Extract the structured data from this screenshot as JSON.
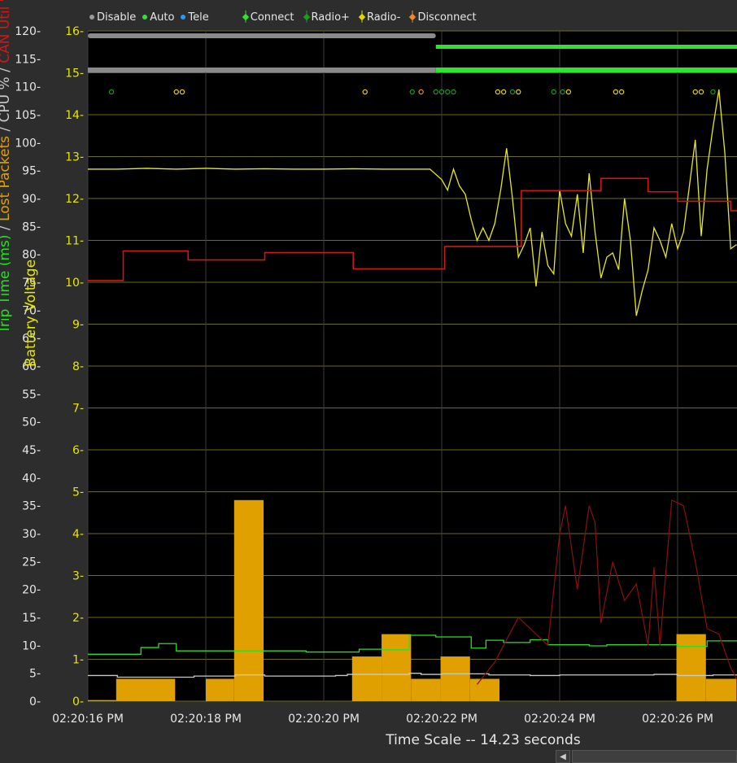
{
  "legend": {
    "modes": [
      {
        "label": "Disable",
        "color": "#9a9a9a"
      },
      {
        "label": "Auto",
        "color": "#31e331"
      },
      {
        "label": "Tele",
        "color": "#2a9af0"
      }
    ],
    "events": [
      {
        "label": "Connect",
        "color": "#31e331"
      },
      {
        "label": "Radio+",
        "color": "#1e9a1e"
      },
      {
        "label": "Radio-",
        "color": "#e7d500"
      },
      {
        "label": "Disconnect",
        "color": "#f08a2a"
      }
    ]
  },
  "colors": {
    "plot_bg": "#000000",
    "grid": "#6b6a1e",
    "axis_text_left": "#e6e6e6",
    "axis_text_batt": "#e7e600",
    "voltage": "#e8e81e",
    "latency": "#d01818",
    "packet_loss": "#e0a000",
    "trip_time": "#28e028",
    "cpu": "#c9c9c9",
    "can_util": "#8a1010"
  },
  "chart_data": {
    "type": "line",
    "xlabel": "Time Scale -- 14.23 seconds",
    "ylabel": "Battery Voltage",
    "ylabel_left_segments": [
      {
        "text": "Trip Time (ms)",
        "color": "#28e028"
      },
      {
        "text": " / ",
        "color": "#c9c9c9"
      },
      {
        "text": "Lost Packets",
        "color": "#e0a000"
      },
      {
        "text": " / ",
        "color": "#c9c9c9"
      },
      {
        "text": "CPU %",
        "color": "#c9c9c9"
      },
      {
        "text": " / ",
        "color": "#c9c9c9"
      },
      {
        "text": "CAN Util %",
        "color": "#d01818"
      }
    ],
    "x_unit": "seconds after 02:20:16 PM",
    "x_range": [
      0,
      11
    ],
    "x_ticks": [
      {
        "value": 0,
        "label": "02:20:16 PM"
      },
      {
        "value": 2,
        "label": "02:20:18 PM"
      },
      {
        "value": 4,
        "label": "02:20:20 PM"
      },
      {
        "value": 6,
        "label": "02:20:22 PM"
      },
      {
        "value": 8,
        "label": "02:20:24 PM"
      },
      {
        "value": 10,
        "label": "02:20:26 PM"
      }
    ],
    "y_left": {
      "range": [
        0,
        120
      ],
      "ticks": [
        0,
        5,
        10,
        15,
        20,
        25,
        30,
        35,
        40,
        45,
        50,
        55,
        60,
        65,
        70,
        75,
        80,
        85,
        90,
        95,
        100,
        105,
        110,
        115,
        120
      ]
    },
    "y_right": {
      "label": "Battery Voltage",
      "range": [
        0,
        16
      ],
      "ticks": [
        0,
        1,
        2,
        3,
        4,
        5,
        6,
        7,
        8,
        9,
        10,
        11,
        12,
        13,
        14,
        15,
        16
      ]
    },
    "grid": true,
    "mode_bar": {
      "disable_until": 5.9,
      "enabled_from": 5.9
    },
    "series": [
      {
        "name": "Battery Voltage",
        "axis": "right",
        "x": [
          0,
          0.5,
          1,
          1.5,
          2,
          2.5,
          3,
          3.5,
          4,
          4.5,
          5,
          5.5,
          5.8,
          6.0,
          6.1,
          6.2,
          6.3,
          6.4,
          6.5,
          6.6,
          6.7,
          6.8,
          6.9,
          7.0,
          7.1,
          7.2,
          7.3,
          7.4,
          7.5,
          7.6,
          7.7,
          7.8,
          7.9,
          8.0,
          8.1,
          8.2,
          8.3,
          8.4,
          8.5,
          8.6,
          8.7,
          8.8,
          8.9,
          9.0,
          9.1,
          9.2,
          9.3,
          9.4,
          9.5,
          9.6,
          9.7,
          9.8,
          9.9,
          10.0,
          10.1,
          10.2,
          10.3,
          10.4,
          10.5,
          10.6,
          10.7,
          10.8,
          10.9,
          11.0
        ],
        "values": [
          12.7,
          12.7,
          12.72,
          12.7,
          12.72,
          12.7,
          12.71,
          12.7,
          12.7,
          12.71,
          12.7,
          12.7,
          12.7,
          12.45,
          12.2,
          12.7,
          12.3,
          12.1,
          11.5,
          11.0,
          11.3,
          11.0,
          11.4,
          12.2,
          13.2,
          12.0,
          10.6,
          10.9,
          11.3,
          9.9,
          11.2,
          10.4,
          10.2,
          12.2,
          11.4,
          11.1,
          12.1,
          10.7,
          12.6,
          11.2,
          10.1,
          10.6,
          10.7,
          10.3,
          12.0,
          11.0,
          9.2,
          9.8,
          10.3,
          11.3,
          11.0,
          10.6,
          11.4,
          10.8,
          11.2,
          12.3,
          13.4,
          11.1,
          12.7,
          13.7,
          14.6,
          13.1,
          10.8,
          10.9
        ]
      },
      {
        "name": "CAN Util %",
        "axis": "left",
        "step": true,
        "x": [
          0,
          0.25,
          0.6,
          1.3,
          1.7,
          2.5,
          3.0,
          3.5,
          4.5,
          5.1,
          5.65,
          6.05,
          6.9,
          7.35,
          7.7,
          8.7,
          9.3,
          9.5,
          9.65,
          10.0,
          10.5,
          10.9,
          11.0
        ],
        "values": [
          75.3,
          75.3,
          80.6,
          80.6,
          79.0,
          79.0,
          80.3,
          80.3,
          77.4,
          77.4,
          77.4,
          81.4,
          81.4,
          91.4,
          91.4,
          93.6,
          93.6,
          91.2,
          91.2,
          89.5,
          89.5,
          87.8,
          87.8
        ]
      },
      {
        "name": "Trip Time (ms)",
        "axis": "left",
        "step": true,
        "x": [
          0,
          0.4,
          0.9,
          1.2,
          1.5,
          2.5,
          3.5,
          3.7,
          4.0,
          4.6,
          5.0,
          5.45,
          5.9,
          6.5,
          6.75,
          7.05,
          7.5,
          7.8,
          8.5,
          8.8,
          9.2,
          10.0,
          10.5,
          11.0
        ],
        "values": [
          8.4,
          8.4,
          9.6,
          10.3,
          9.0,
          9.0,
          9.0,
          8.8,
          8.8,
          9.3,
          9.2,
          11.8,
          11.5,
          9.5,
          10.9,
          10.5,
          11.0,
          10.1,
          9.9,
          10.1,
          10.1,
          9.8,
          10.8,
          10.8
        ]
      },
      {
        "name": "CPU %",
        "axis": "left",
        "step": true,
        "x": [
          0,
          0.2,
          0.5,
          1.8,
          2.5,
          3.0,
          4.2,
          4.4,
          5.45,
          5.65,
          6.0,
          6.8,
          7.5,
          8.0,
          9.0,
          9.6,
          10.0,
          10.6,
          11.0
        ],
        "values": [
          4.6,
          4.6,
          4.3,
          4.5,
          4.7,
          4.5,
          4.6,
          4.8,
          5.0,
          4.8,
          4.9,
          4.7,
          4.6,
          4.7,
          4.7,
          4.8,
          4.6,
          4.7,
          4.7
        ]
      },
      {
        "name": "CAN burst",
        "axis": "left",
        "x": [
          6.6,
          6.9,
          7.3,
          7.8,
          8.0,
          8.1,
          8.3,
          8.5,
          8.6,
          8.7,
          8.9,
          9.1,
          9.3,
          9.5,
          9.6,
          9.7,
          9.9,
          10.1,
          10.3,
          10.5,
          10.7,
          10.9,
          11.0
        ],
        "values": [
          3,
          7,
          15,
          10,
          30,
          35,
          20,
          35,
          32,
          14,
          25,
          18,
          21,
          10,
          24,
          10,
          36,
          35,
          25,
          13,
          12,
          6,
          4
        ]
      }
    ],
    "lost_packets": {
      "axis": "left",
      "bars": [
        {
          "x0": 0,
          "x1": 0.48,
          "value": 0.2
        },
        {
          "x0": 0.48,
          "x1": 1.48,
          "value": 4.0
        },
        {
          "x0": 2.0,
          "x1": 2.48,
          "value": 4.0
        },
        {
          "x0": 2.48,
          "x1": 2.98,
          "value": 36.0
        },
        {
          "x0": 4.48,
          "x1": 4.98,
          "value": 8.0
        },
        {
          "x0": 4.98,
          "x1": 5.48,
          "value": 12.0
        },
        {
          "x0": 5.48,
          "x1": 5.98,
          "value": 4.0
        },
        {
          "x0": 5.98,
          "x1": 6.48,
          "value": 8.0
        },
        {
          "x0": 6.48,
          "x1": 6.98,
          "value": 4.0
        },
        {
          "x0": 9.98,
          "x1": 10.48,
          "value": 12.0
        },
        {
          "x0": 10.48,
          "x1": 11.0,
          "value": 4.0
        }
      ]
    },
    "event_markers": [
      {
        "x": 0.4,
        "type": "Radio+"
      },
      {
        "x": 1.5,
        "type": "Radio-"
      },
      {
        "x": 1.6,
        "type": "Radio-"
      },
      {
        "x": 4.7,
        "type": "Radio-"
      },
      {
        "x": 5.5,
        "type": "Radio+"
      },
      {
        "x": 5.65,
        "type": "Disconnect"
      },
      {
        "x": 5.9,
        "type": "Radio+"
      },
      {
        "x": 6.0,
        "type": "Radio+"
      },
      {
        "x": 6.1,
        "type": "Radio+"
      },
      {
        "x": 6.2,
        "type": "Radio+"
      },
      {
        "x": 6.95,
        "type": "Radio-"
      },
      {
        "x": 7.05,
        "type": "Radio-"
      },
      {
        "x": 7.2,
        "type": "Radio+"
      },
      {
        "x": 7.3,
        "type": "Radio-"
      },
      {
        "x": 7.9,
        "type": "Radio+"
      },
      {
        "x": 8.05,
        "type": "Radio+"
      },
      {
        "x": 8.15,
        "type": "Radio-"
      },
      {
        "x": 8.95,
        "type": "Radio-"
      },
      {
        "x": 9.05,
        "type": "Radio-"
      },
      {
        "x": 10.3,
        "type": "Radio-"
      },
      {
        "x": 10.4,
        "type": "Radio-"
      },
      {
        "x": 10.6,
        "type": "Radio+"
      }
    ]
  }
}
